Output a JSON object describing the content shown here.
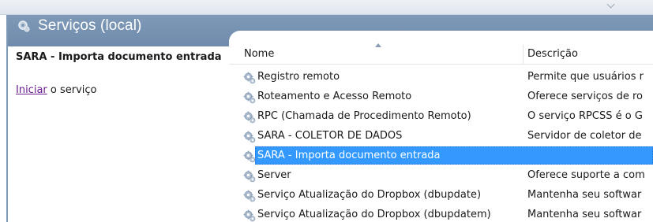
{
  "header": {
    "title": "Serviços (local)",
    "icon": "services-icon"
  },
  "left_pane": {
    "service_name": "SARA - Importa documento entrada",
    "action_link": "Iniciar",
    "action_suffix": " o serviço"
  },
  "list": {
    "columns": {
      "name": "Nome",
      "description": "Descrição"
    },
    "sort": "ascending",
    "rows": [
      {
        "name": "Registro remoto",
        "description": "Permite que usuários r",
        "icon": "gear-icon"
      },
      {
        "name": "Roteamento e Acesso Remoto",
        "description": "Oferece serviços de ro",
        "icon": "gear-icon"
      },
      {
        "name": "RPC (Chamada de Procedimento Remoto)",
        "description": "O serviço RPCSS é o G",
        "icon": "gear-icon"
      },
      {
        "name": "SARA - COLETOR DE DADOS",
        "description": "Servidor de coletor de",
        "icon": "gear-icon"
      },
      {
        "name": "SARA - Importa documento entrada",
        "description": "",
        "icon": "gear-icon",
        "selected": true
      },
      {
        "name": "Server",
        "description": "Oferece suporte a com",
        "icon": "gear-icon"
      },
      {
        "name": "Serviço Atualização do Dropbox (dbupdate)",
        "description": "Mantenha seu softwar",
        "icon": "gear-icon"
      },
      {
        "name": "Serviço Atualização do Dropbox (dbupdatem)",
        "description": "Mantenha seu softwar",
        "icon": "gear-icon"
      }
    ]
  },
  "colors": {
    "header_band": "#7f9ab8",
    "selection": "#3399ff",
    "link": "#6b1d8f"
  }
}
